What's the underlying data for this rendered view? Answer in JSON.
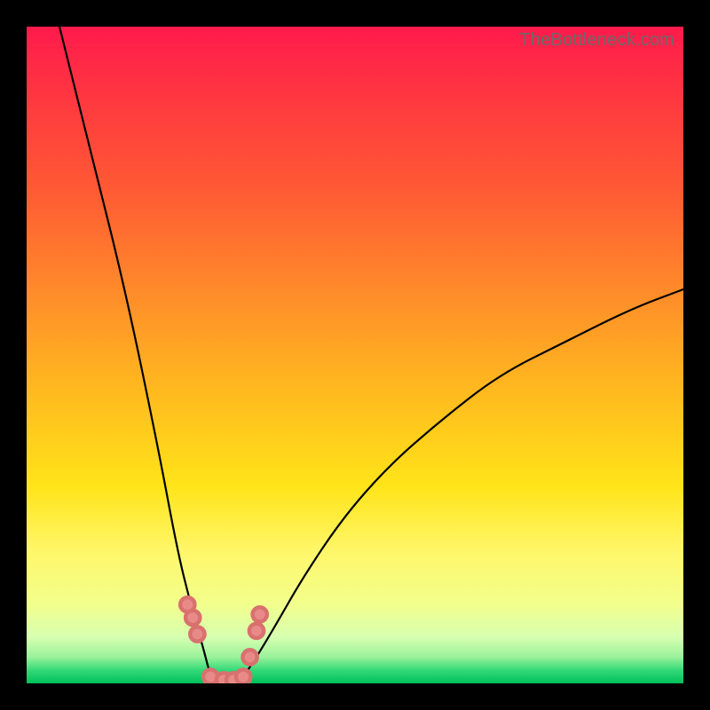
{
  "watermark": "TheBottleneck.com",
  "colors": {
    "frame": "#000000",
    "marker": "#e88a88",
    "curve": "#000000",
    "gradient_stops": [
      "#ff1a4c",
      "#ff3a3f",
      "#ff5a34",
      "#ff8a2a",
      "#ffb81f",
      "#ffe419",
      "#fff76a",
      "#f2ff8d",
      "#d7ffb0",
      "#99f29a",
      "#33d977",
      "#00c05a"
    ]
  },
  "chart_data": {
    "type": "line",
    "title": "",
    "xlabel": "",
    "ylabel": "",
    "xlim": [
      0,
      100
    ],
    "ylim": [
      0,
      100
    ],
    "notes": "Single V-shaped curve; minimum (~0) near x≈28–33. Left branch steep from (5,100)→(28,0). Right branch rises with decreasing slope to (100,~60). Background is a vertical heat gradient (red top → green bottom). Small salmon-colored dot markers cluster around the trough.",
    "series": [
      {
        "name": "bottleneck-curve",
        "x": [
          5,
          10,
          15,
          20,
          23,
          25,
          27,
          28,
          30,
          32,
          33,
          35,
          38,
          42,
          48,
          55,
          63,
          72,
          82,
          92,
          100
        ],
        "y": [
          100,
          80,
          60,
          36,
          20,
          12,
          5,
          1,
          0,
          0,
          1,
          4,
          9,
          16,
          25,
          33,
          40,
          47,
          52,
          57,
          60
        ]
      }
    ],
    "markers": {
      "name": "trough-dots",
      "x": [
        24.5,
        25.3,
        26.0,
        28.0,
        30.0,
        31.5,
        33.0,
        34.0,
        35.0,
        35.5
      ],
      "y": [
        12.0,
        10.0,
        7.5,
        1.0,
        0.5,
        0.5,
        1.0,
        4.0,
        8.0,
        10.5
      ]
    }
  }
}
